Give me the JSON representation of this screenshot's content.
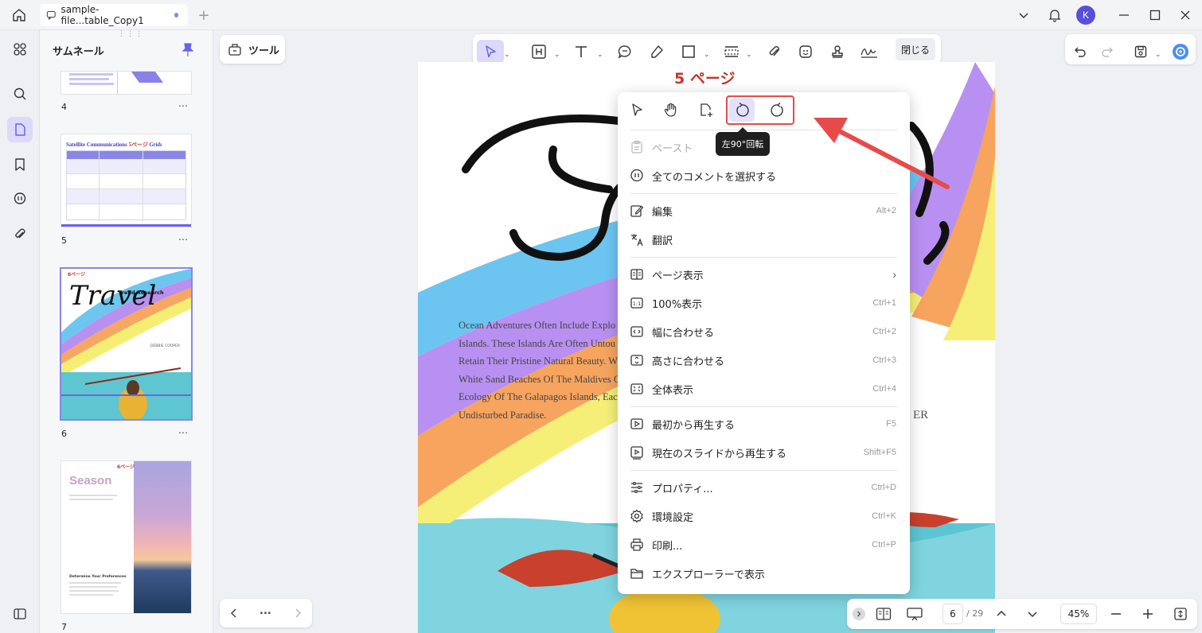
{
  "tab": {
    "title": "sample-file...table_Copy1"
  },
  "avatar": {
    "initial": "K"
  },
  "thumbs": {
    "title": "サムネール",
    "pages": [
      {
        "num": "4"
      },
      {
        "num": "5",
        "heading": "Satellite Communications",
        "heading2": "Grids",
        "stamp": "5ページ"
      },
      {
        "num": "6",
        "title": "Travel",
        "subtitle": "Trend Research",
        "author": "DEBBIE COOPER",
        "stamp": "6ページ"
      },
      {
        "num": "7",
        "title": "Season",
        "subtitle": "Determine Your Preferences",
        "stamp": "6ページ"
      }
    ]
  },
  "toolbar": {
    "tools_label": "ツール",
    "close_label": "閉じる"
  },
  "page": {
    "stamp": "5 ページ",
    "body_text": "Ocean Adventures Often Include Explo Islands. These Islands Are Often Untou Retain Their Pristine Natural Beauty. W White Sand Beaches Of The Maldives C Ecology Of The Galapagos Islands, Eac An Undisturbed Paradise.",
    "author_fragment": "ER"
  },
  "menu": {
    "tooltip": "左90°回転",
    "items": [
      {
        "label": "ペースト",
        "shortcut": "",
        "disabled": true
      },
      {
        "label": "全てのコメントを選択する",
        "shortcut": ""
      },
      {
        "label": "編集",
        "shortcut": "Alt+2"
      },
      {
        "label": "翻訳",
        "shortcut": ""
      },
      {
        "label": "ページ表示",
        "shortcut": ""
      },
      {
        "label": "100%表示",
        "shortcut": "Ctrl+1"
      },
      {
        "label": "幅に合わせる",
        "shortcut": "Ctrl+2"
      },
      {
        "label": "高さに合わせる",
        "shortcut": "Ctrl+3"
      },
      {
        "label": "全体表示",
        "shortcut": "Ctrl+4"
      },
      {
        "label": "最初から再生する",
        "shortcut": "F5"
      },
      {
        "label": "現在のスライドから再生する",
        "shortcut": "Shift+F5"
      },
      {
        "label": "プロパティ...",
        "shortcut": "Ctrl+D"
      },
      {
        "label": "環境設定",
        "shortcut": "Ctrl+K"
      },
      {
        "label": "印刷...",
        "shortcut": "Ctrl+P"
      },
      {
        "label": "エクスプローラーで表示",
        "shortcut": ""
      }
    ]
  },
  "nav": {
    "more": "..."
  },
  "pager": {
    "current": "6",
    "total": "/ 29",
    "zoom": "45%"
  },
  "colors": {
    "accent": "#6b63e6",
    "highlight": "#e84a4a",
    "brand_dark": "#c0392b"
  }
}
